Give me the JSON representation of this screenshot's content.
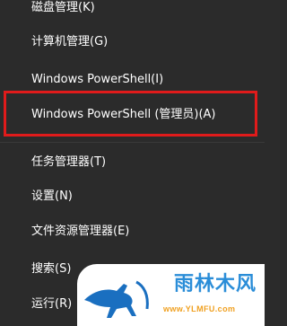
{
  "menu": {
    "items": [
      {
        "label": "磁盘管理(K)"
      },
      {
        "label": "计算机管理(G)"
      },
      {
        "label": "Windows PowerShell(I)"
      },
      {
        "label": "Windows PowerShell (管理员)(A)"
      },
      {
        "label": "任务管理器(T)"
      },
      {
        "label": "设置(N)"
      },
      {
        "label": "文件资源管理器(E)"
      },
      {
        "label": "搜索(S)"
      },
      {
        "label": "运行(R)"
      }
    ]
  },
  "watermark": {
    "brand": "雨林木风",
    "url": "www.YLMFU.com",
    "colors": {
      "brand": "#2a8dd8",
      "url": "#f0a020",
      "logo": "#1a6fc0"
    }
  },
  "highlight_color": "#e01b1b",
  "menu_background": "#2b2b2b"
}
